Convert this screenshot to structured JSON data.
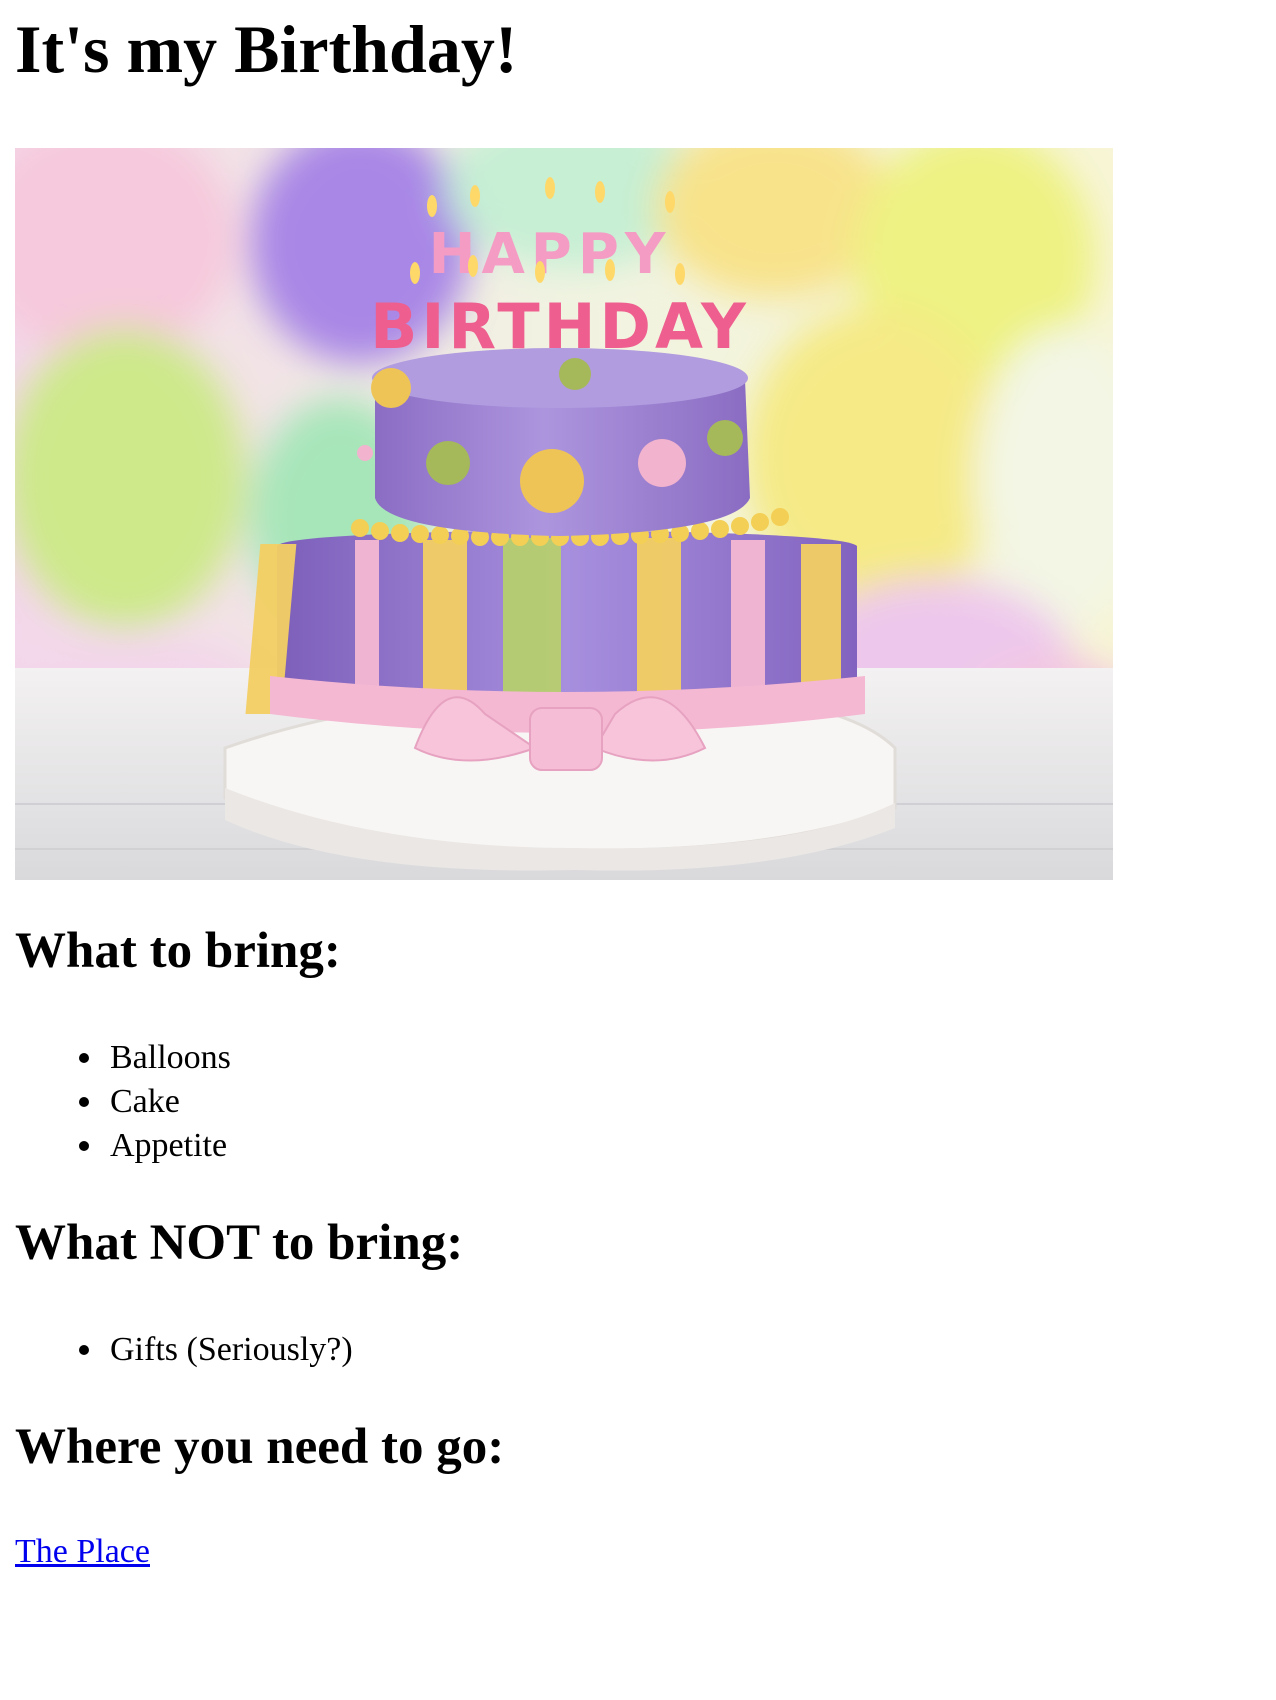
{
  "page": {
    "title": "It's my Birthday!",
    "image_alt": "Birthday cake with HAPPY BIRTHDAY candles",
    "candles_top": "HAPPY",
    "candles_bottom": "BIRTHDAY"
  },
  "bring": {
    "heading": "What to bring:",
    "items": [
      "Balloons",
      "Cake",
      "Appetite"
    ]
  },
  "not_bring": {
    "heading": "What NOT to bring:",
    "items": [
      "Gifts (Seriously?)"
    ]
  },
  "where": {
    "heading": "Where you need to go:",
    "link_text": "The Place"
  },
  "colors": {
    "link": "#0000ee",
    "cake_purple": "#9a7fd0",
    "ribbon_pink": "#f4b8d2",
    "ribbon_yellow": "#f4cf63",
    "ribbon_green": "#b6cf6e"
  }
}
